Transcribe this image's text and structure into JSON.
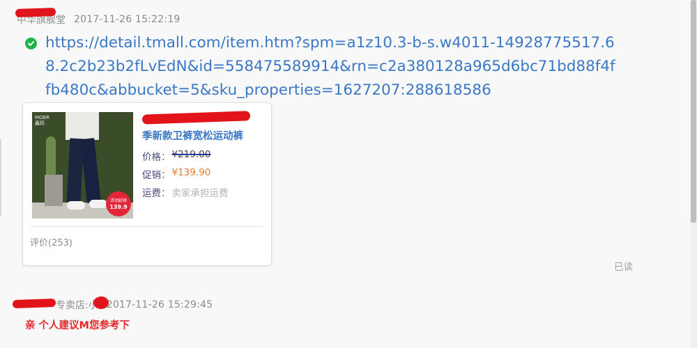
{
  "messages": [
    {
      "sender": "中华旗舰堂",
      "timestamp": "2017-11-26 15:22:19",
      "link": "https://detail.tmall.com/item.htm?spm=a1z10.3-b-s.w4011-14928775517.68.2c2b23b2fLvEdN&id=558475589914&rn=c2a380128a965d6bc71bd88f4ffb480c&abbucket=5&sku_properties=1627207:288618586"
    },
    {
      "sender": "专卖店:小",
      "timestamp": "2017-11-26 15:29:45",
      "text": "亲 个人建议M您参考下"
    }
  ],
  "product_card": {
    "title": "季新款卫裤宽松运动裤",
    "thumb_brand": "MOBR\n鑫跃",
    "thumb_badge": "活动延续",
    "thumb_price": "139.9",
    "price_label": "价格",
    "price_value": "¥219.00",
    "promo_label": "促销",
    "promo_value": "¥139.90",
    "shipping_label": "运费",
    "shipping_value": "卖家承担运费",
    "reviews": "评价(253)"
  },
  "read_status": "已读",
  "colors": {
    "link": "#3b78c4",
    "promo": "#e07a34",
    "reply": "#e02a2a",
    "check": "#1fb34a"
  }
}
